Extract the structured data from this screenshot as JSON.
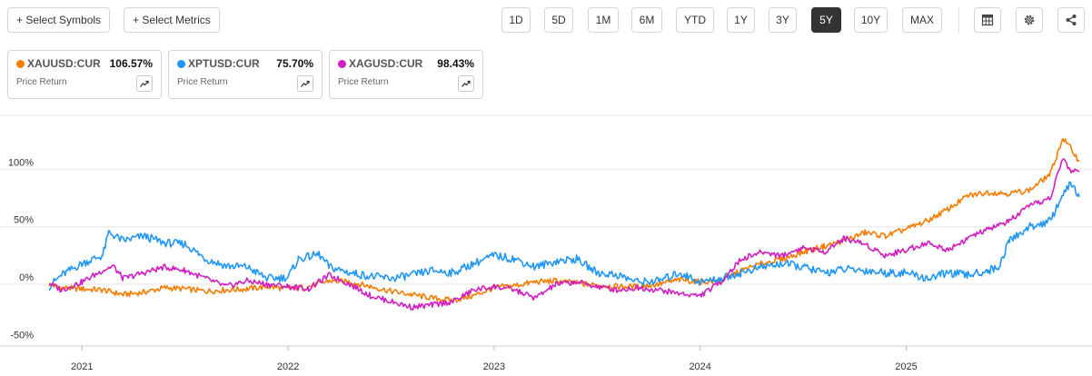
{
  "toolbar": {
    "select_symbols": "+ Select Symbols",
    "select_metrics": "+ Select Metrics",
    "ranges": [
      "1D",
      "5D",
      "1M",
      "6M",
      "YTD",
      "1Y",
      "3Y",
      "5Y",
      "10Y",
      "MAX"
    ],
    "active_range": "5Y",
    "icons": [
      "table-icon",
      "gear-icon",
      "share-icon"
    ]
  },
  "legend": [
    {
      "symbol": "XAUUSD:CUR",
      "value": "106.57%",
      "metric": "Price Return",
      "color": "#f57c00"
    },
    {
      "symbol": "XPTUSD:CUR",
      "value": "75.70%",
      "metric": "Price Return",
      "color": "#2196f3"
    },
    {
      "symbol": "XAGUSD:CUR",
      "value": "98.43%",
      "metric": "Price Return",
      "color": "#d01fc0"
    }
  ],
  "chart_data": {
    "type": "line",
    "x_ticks": [
      "2021",
      "2022",
      "2023",
      "2024",
      "2025"
    ],
    "y_ticks": [
      "100%",
      "50%",
      "0%",
      "-50%"
    ],
    "ylim": [
      -50,
      135
    ],
    "xlim": [
      2020.84,
      2025.84
    ],
    "grid": true,
    "series": [
      {
        "name": "XAUUSD:CUR",
        "color": "#f57c00",
        "points": [
          [
            2020.84,
            0
          ],
          [
            2020.9,
            -3
          ],
          [
            2021.0,
            -4
          ],
          [
            2021.1,
            -5
          ],
          [
            2021.2,
            -9
          ],
          [
            2021.3,
            -7
          ],
          [
            2021.4,
            -3
          ],
          [
            2021.5,
            -4
          ],
          [
            2021.6,
            -6
          ],
          [
            2021.7,
            -5
          ],
          [
            2021.8,
            -4
          ],
          [
            2021.9,
            -2
          ],
          [
            2022.0,
            -4
          ],
          [
            2022.1,
            -2
          ],
          [
            2022.2,
            3
          ],
          [
            2022.3,
            2
          ],
          [
            2022.4,
            -2
          ],
          [
            2022.5,
            -6
          ],
          [
            2022.6,
            -9
          ],
          [
            2022.7,
            -12
          ],
          [
            2022.8,
            -14
          ],
          [
            2022.9,
            -10
          ],
          [
            2023.0,
            -3
          ],
          [
            2023.1,
            -1
          ],
          [
            2023.2,
            2
          ],
          [
            2023.3,
            3
          ],
          [
            2023.4,
            1
          ],
          [
            2023.5,
            -1
          ],
          [
            2023.6,
            -2
          ],
          [
            2023.7,
            -2
          ],
          [
            2023.8,
            0
          ],
          [
            2023.9,
            4
          ],
          [
            2024.0,
            2
          ],
          [
            2024.1,
            3
          ],
          [
            2024.2,
            12
          ],
          [
            2024.3,
            18
          ],
          [
            2024.4,
            22
          ],
          [
            2024.5,
            28
          ],
          [
            2024.6,
            33
          ],
          [
            2024.7,
            38
          ],
          [
            2024.8,
            45
          ],
          [
            2024.9,
            42
          ],
          [
            2025.0,
            48
          ],
          [
            2025.1,
            55
          ],
          [
            2025.2,
            65
          ],
          [
            2025.3,
            77
          ],
          [
            2025.4,
            80
          ],
          [
            2025.5,
            79
          ],
          [
            2025.6,
            82
          ],
          [
            2025.7,
            96
          ],
          [
            2025.76,
            127
          ],
          [
            2025.8,
            118
          ],
          [
            2025.84,
            107
          ]
        ]
      },
      {
        "name": "XPTUSD:CUR",
        "color": "#2196f3",
        "points": [
          [
            2020.84,
            -2
          ],
          [
            2020.9,
            8
          ],
          [
            2021.0,
            18
          ],
          [
            2021.1,
            25
          ],
          [
            2021.13,
            45
          ],
          [
            2021.2,
            38
          ],
          [
            2021.3,
            42
          ],
          [
            2021.4,
            36
          ],
          [
            2021.5,
            35
          ],
          [
            2021.6,
            22
          ],
          [
            2021.7,
            16
          ],
          [
            2021.8,
            15
          ],
          [
            2021.9,
            5
          ],
          [
            2022.0,
            6
          ],
          [
            2022.05,
            22
          ],
          [
            2022.15,
            26
          ],
          [
            2022.2,
            15
          ],
          [
            2022.3,
            10
          ],
          [
            2022.4,
            7
          ],
          [
            2022.5,
            5
          ],
          [
            2022.6,
            8
          ],
          [
            2022.7,
            12
          ],
          [
            2022.8,
            10
          ],
          [
            2022.9,
            18
          ],
          [
            2023.0,
            25
          ],
          [
            2023.1,
            22
          ],
          [
            2023.2,
            15
          ],
          [
            2023.3,
            20
          ],
          [
            2023.4,
            22
          ],
          [
            2023.5,
            10
          ],
          [
            2023.6,
            8
          ],
          [
            2023.7,
            2
          ],
          [
            2023.8,
            3
          ],
          [
            2023.9,
            10
          ],
          [
            2024.0,
            2
          ],
          [
            2024.1,
            5
          ],
          [
            2024.2,
            10
          ],
          [
            2024.3,
            15
          ],
          [
            2024.4,
            18
          ],
          [
            2024.5,
            15
          ],
          [
            2024.6,
            10
          ],
          [
            2024.7,
            13
          ],
          [
            2024.8,
            12
          ],
          [
            2024.9,
            10
          ],
          [
            2025.0,
            10
          ],
          [
            2025.1,
            5
          ],
          [
            2025.2,
            10
          ],
          [
            2025.3,
            8
          ],
          [
            2025.4,
            12
          ],
          [
            2025.45,
            15
          ],
          [
            2025.5,
            38
          ],
          [
            2025.6,
            50
          ],
          [
            2025.7,
            55
          ],
          [
            2025.75,
            75
          ],
          [
            2025.8,
            88
          ],
          [
            2025.84,
            76
          ]
        ]
      },
      {
        "name": "XAGUSD:CUR",
        "color": "#d01fc0",
        "points": [
          [
            2020.84,
            1
          ],
          [
            2020.9,
            -5
          ],
          [
            2021.0,
            2
          ],
          [
            2021.1,
            12
          ],
          [
            2021.15,
            16
          ],
          [
            2021.2,
            5
          ],
          [
            2021.3,
            10
          ],
          [
            2021.4,
            15
          ],
          [
            2021.5,
            12
          ],
          [
            2021.6,
            5
          ],
          [
            2021.7,
            -2
          ],
          [
            2021.8,
            3
          ],
          [
            2021.9,
            0
          ],
          [
            2022.0,
            -2
          ],
          [
            2022.1,
            -4
          ],
          [
            2022.2,
            8
          ],
          [
            2022.3,
            0
          ],
          [
            2022.4,
            -10
          ],
          [
            2022.5,
            -15
          ],
          [
            2022.6,
            -20
          ],
          [
            2022.7,
            -18
          ],
          [
            2022.8,
            -15
          ],
          [
            2022.9,
            -5
          ],
          [
            2023.0,
            -2
          ],
          [
            2023.1,
            -5
          ],
          [
            2023.2,
            -12
          ],
          [
            2023.3,
            0
          ],
          [
            2023.4,
            2
          ],
          [
            2023.5,
            -2
          ],
          [
            2023.6,
            -5
          ],
          [
            2023.7,
            -3
          ],
          [
            2023.8,
            -5
          ],
          [
            2023.9,
            -8
          ],
          [
            2024.0,
            -10
          ],
          [
            2024.1,
            2
          ],
          [
            2024.2,
            22
          ],
          [
            2024.3,
            28
          ],
          [
            2024.4,
            25
          ],
          [
            2024.5,
            32
          ],
          [
            2024.6,
            28
          ],
          [
            2024.7,
            40
          ],
          [
            2024.8,
            35
          ],
          [
            2024.9,
            25
          ],
          [
            2025.0,
            30
          ],
          [
            2025.1,
            36
          ],
          [
            2025.2,
            30
          ],
          [
            2025.3,
            40
          ],
          [
            2025.4,
            48
          ],
          [
            2025.5,
            55
          ],
          [
            2025.6,
            68
          ],
          [
            2025.7,
            75
          ],
          [
            2025.76,
            110
          ],
          [
            2025.8,
            98
          ],
          [
            2025.84,
            98
          ]
        ]
      }
    ]
  }
}
